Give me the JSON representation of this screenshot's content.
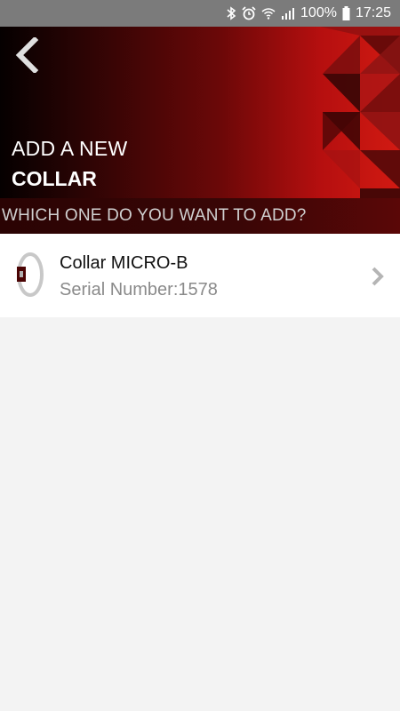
{
  "status_bar": {
    "battery": "100%",
    "time": "17:25",
    "icons": [
      "bluetooth-icon",
      "alarm-icon",
      "wifi-icon",
      "signal-icon",
      "battery-icon"
    ]
  },
  "header": {
    "title_line1": "ADD A NEW",
    "title_line2": "COLLAR",
    "back_icon": "chevron-left-icon"
  },
  "subheader": {
    "text": "WHICH ONE DO YOU WANT TO ADD?"
  },
  "devices": [
    {
      "name": "Collar MICRO-B",
      "serial": "Serial Number:1578",
      "icon": "collar-icon"
    }
  ],
  "colors": {
    "accent_red": "#d21a12",
    "dark_red": "#3a0606",
    "background": "#f3f3f3"
  }
}
